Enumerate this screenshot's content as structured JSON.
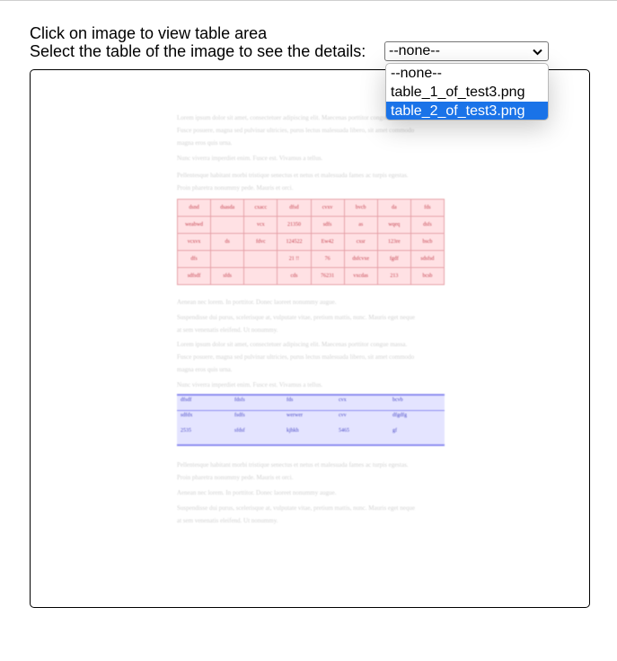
{
  "instructions": {
    "line1": "Click on image to view table area",
    "line2": "Select the table of the image to see the details:"
  },
  "select": {
    "value": "--none--",
    "options": [
      "--none--",
      "table_1_of_test3.png",
      "table_2_of_test3.png"
    ],
    "highlighted": "table_2_of_test3.png"
  },
  "document": {
    "paragraphs": [
      [
        "Lorem ipsum dolor sit amet, consectetuer adipiscing elit. Maecenas porttitor congue massa.",
        "Fusce posuere, magna sed pulvinar ultricies, purus lectus malesuada libero, sit amet commodo",
        "magna eros quis urna."
      ],
      [
        "Nunc viverra imperdiet enim. Fusce est. Vivamus a tellus."
      ],
      [
        "Pellentesque habitant morbi tristique senectus et netus et malesuada fames ac turpis egestas.",
        "Proin pharetra nonummy pede. Mauris et orci."
      ],
      [
        "Aenean nec lorem. In porttitor. Donec laoreet nonummy augue."
      ],
      [
        "Suspendisse dui purus, scelerisque at, vulputate vitae, pretium mattis, nunc. Mauris eget neque",
        "at sem venenatis eleifend. Ut nonummy."
      ],
      [
        "Lorem ipsum dolor sit amet, consectetuer adipiscing elit. Maecenas porttitor congue massa.",
        "Fusce posuere, magna sed pulvinar ultricies, purus lectus malesuada libero, sit amet commodo",
        "magna eros quis urna."
      ],
      [
        "Nunc viverra imperdiet enim. Fusce est. Vivamus a tellus."
      ],
      [
        "Pellentesque habitant morbi tristique senectus et netus et malesuada fames ac turpis egestas.",
        "Proin pharetra nonummy pede. Mauris et orci."
      ],
      [
        "Aenean nec lorem. In porttitor. Donec laoreet nonummy augue."
      ],
      [
        "Suspendisse dui purus, scelerisque at, vulputate vitae, pretium mattis, nunc. Mauris eget neque",
        "at sem venenatis eleifend. Ut nonummy."
      ]
    ],
    "table1": [
      [
        "dsnd",
        "dsasda",
        "cxacc",
        "dfsd",
        "cvxv",
        "bvcb",
        "da",
        "fds"
      ],
      [
        "weabwd",
        "",
        "vcx",
        "21350",
        "sdfs",
        "as",
        "wqeq",
        "dsfs"
      ],
      [
        "vcxvx",
        "ds",
        "fdvc",
        "124522",
        "Ew42",
        "cxsr",
        "123re",
        "bscb"
      ],
      [
        "dfs",
        "",
        "",
        "21 !!",
        "76",
        "dsfcvxe",
        "fgdf",
        "sdsfsd"
      ],
      [
        "sdfsdf",
        "sfds",
        "",
        "cds",
        "76231",
        "vxcdas",
        "213",
        "bcsb"
      ]
    ],
    "table2": [
      [
        "dfsdf",
        "fdsfs",
        "fds",
        "cvx",
        "bcvb"
      ],
      [
        "sdfdx",
        "fsdfs",
        "werwer",
        "cvv",
        "dfgdfg"
      ],
      [
        "2535",
        "sfdsf",
        "kjhkh",
        "5465",
        "gf"
      ]
    ]
  },
  "colors": {
    "option_highlight": "#1a73e8",
    "table1_fill": "#ffe1e4",
    "table1_border": "#e6a1a8",
    "table2_fill": "#e4e4ff",
    "table2_border": "#8d8df0"
  }
}
